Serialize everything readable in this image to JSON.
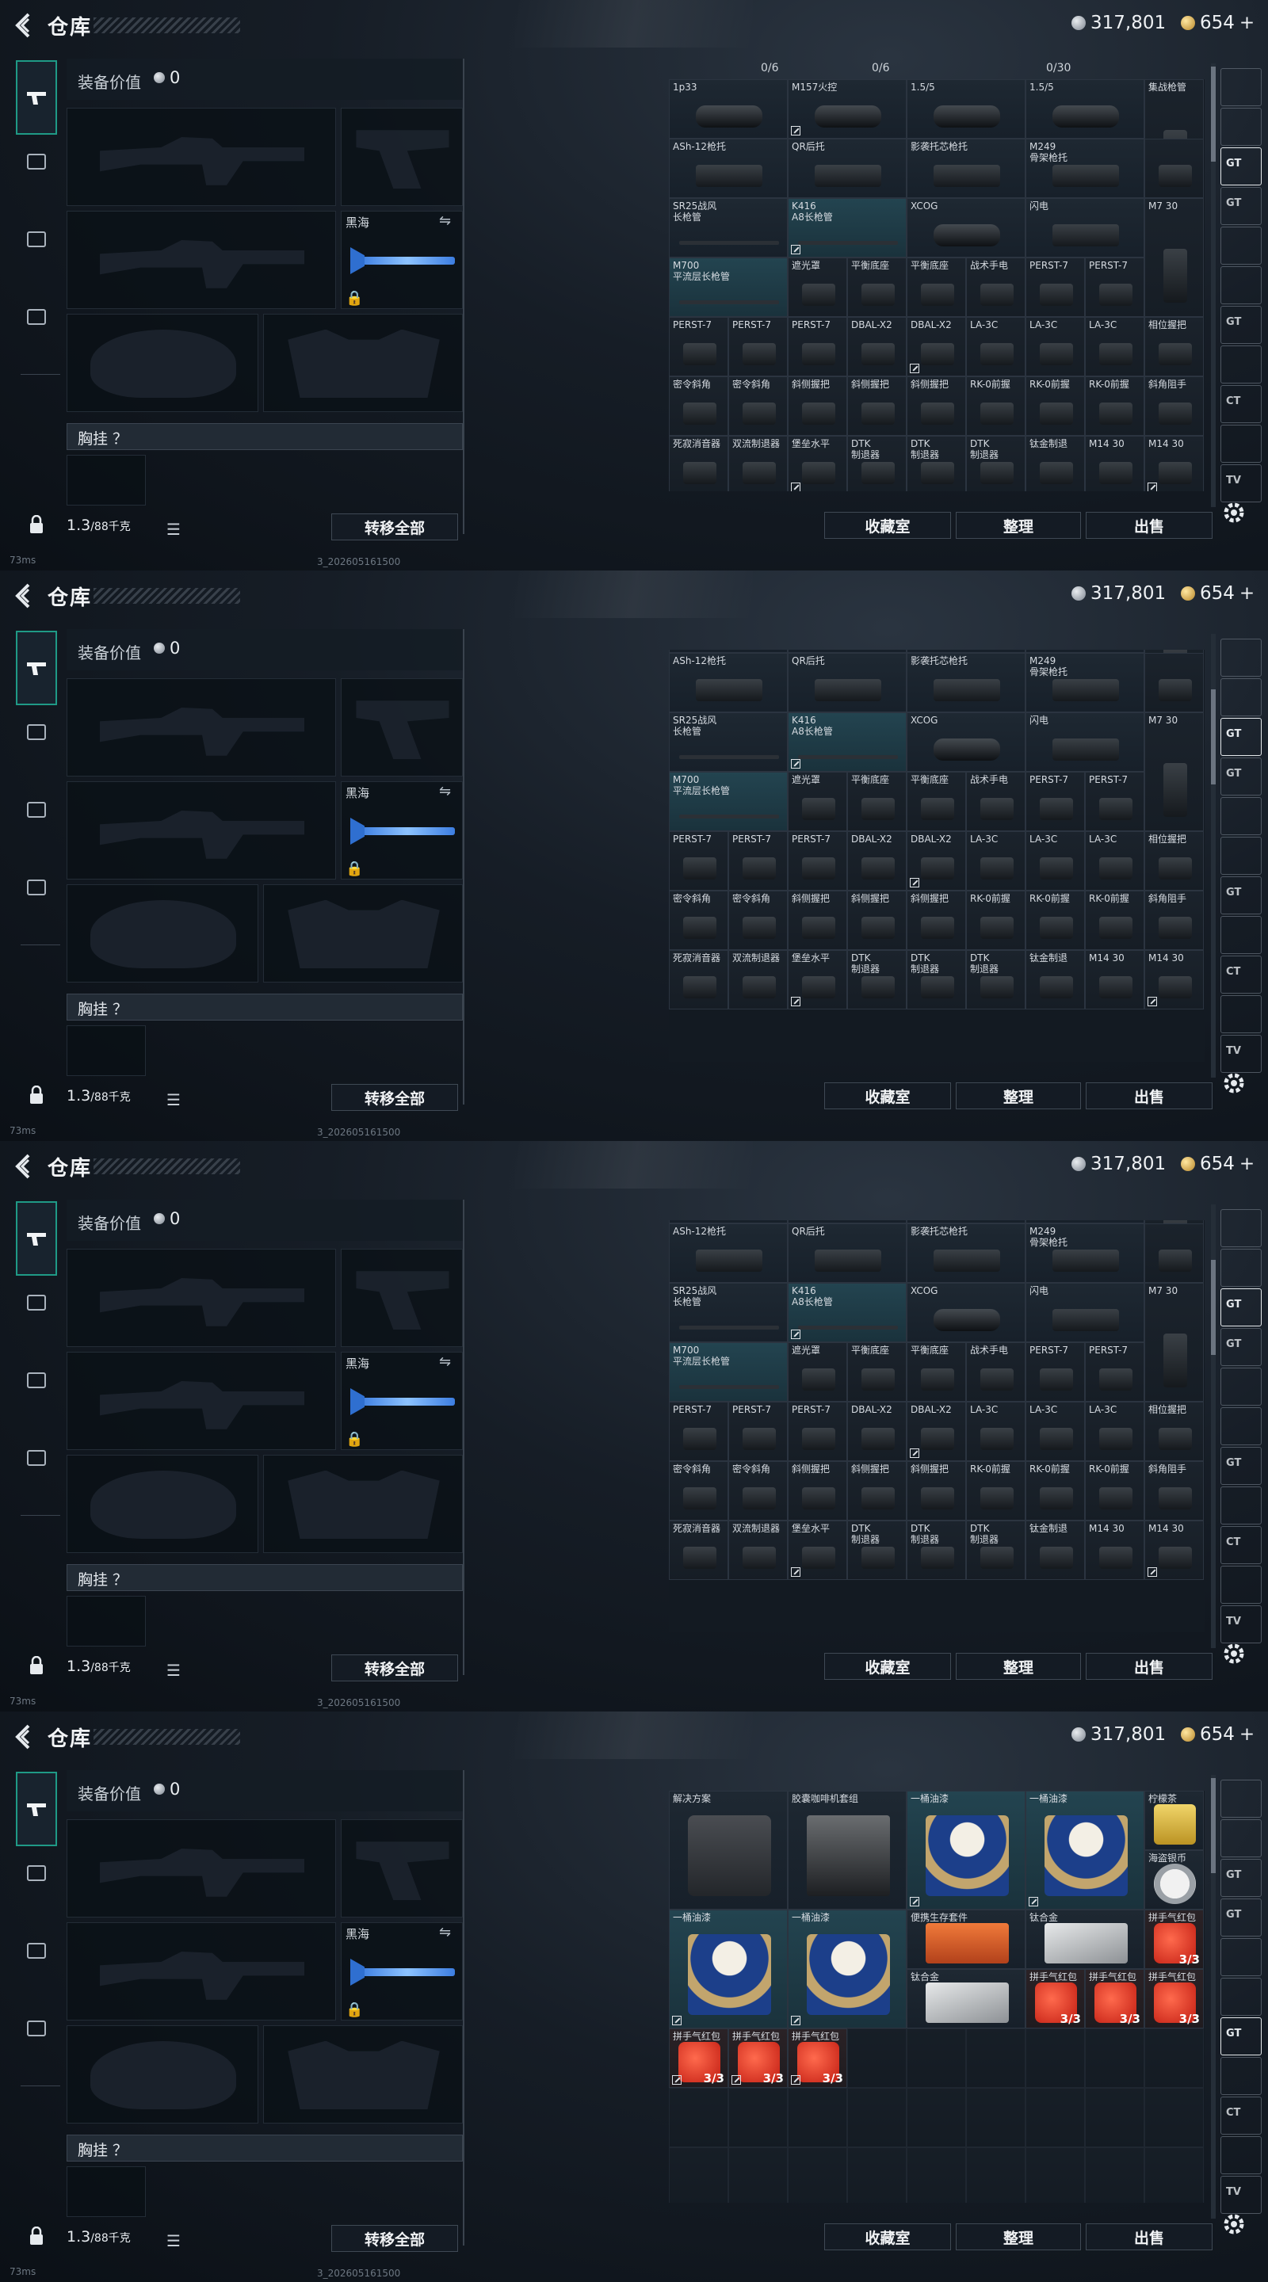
{
  "screens": [
    {
      "id": "s1",
      "variant": "attachments",
      "offset": 0
    },
    {
      "id": "s2",
      "variant": "attachments-scrolled",
      "offset": 1
    },
    {
      "id": "s3",
      "variant": "attachments-scrolled",
      "offset": 1
    },
    {
      "id": "s4",
      "variant": "consumables",
      "offset": 0
    }
  ],
  "header": {
    "title": "仓库",
    "silver": "317,801",
    "gold": "654",
    "gold_plus": "+"
  },
  "loadout": {
    "value_label": "装备价值",
    "value": "0",
    "knife_label": "黑海",
    "chest_label": "胸挂 ？",
    "weight": "1.3",
    "weight_cap": "/88千克",
    "transfer_all": "转移全部"
  },
  "warehouse": {
    "filters": [
      "0/6",
      "0/6",
      "0/30"
    ],
    "buttons": {
      "vault": "收藏室",
      "sort": "整理",
      "sell": "出售"
    },
    "attachments": [
      {
        "row": 0,
        "cells": [
          "1p33",
          "M157火控",
          "1.5/5",
          "1.5/5",
          "集战枪管"
        ]
      },
      {
        "row": 1,
        "cells": [
          "ASh-12枪托",
          "QR后托",
          "影袭托芯枪托",
          "M249\n骨架枪托",
          ""
        ]
      },
      {
        "row": 2,
        "cells": [
          "SR25战风\n长枪管",
          "K416\nA8长枪管",
          "XCOG",
          "闪电",
          "M7 30"
        ]
      },
      {
        "row": 3,
        "cells": [
          "M700\n平流层长枪管",
          "遮光罩",
          "平衡底座",
          "平衡底座",
          "战术手电",
          "PERST-7",
          "PERST-7"
        ]
      },
      {
        "row": 4,
        "cells": [
          "PERST-7",
          "PERST-7",
          "PERST-7",
          "DBAL-X2",
          "DBAL-X2",
          "LA-3C",
          "LA-3C",
          "LA-3C",
          "相位握把"
        ]
      },
      {
        "row": 5,
        "cells": [
          "密令斜角",
          "密令斜角",
          "斜侧握把",
          "斜侧握把",
          "斜侧握把",
          "RK-0前握",
          "RK-0前握",
          "RK-0前握",
          "斜角阻手"
        ]
      },
      {
        "row": 6,
        "cells": [
          "死寂消音器",
          "双流制退器",
          "堡垒水平",
          "DTK\n制退器",
          "DTK\n制退器",
          "DTK\n制退器",
          "钛金制退",
          "M14 30",
          "M14 30"
        ]
      }
    ],
    "consumables": [
      {
        "name": "解决方案"
      },
      {
        "name": "胶囊咖啡机套组"
      },
      {
        "name": "一桶油漆"
      },
      {
        "name": "一桶油漆"
      },
      {
        "name": "柠檬茶"
      },
      {
        "name": "海盗银币"
      },
      {
        "name": "一桶油漆"
      },
      {
        "name": "一桶油漆"
      },
      {
        "name": "便携生存套件"
      },
      {
        "name": "钛合金"
      },
      {
        "name": "拼手气红包",
        "count": "3/3"
      },
      {
        "name": "钛合金"
      },
      {
        "name": "拼手气红包",
        "count": "3/3"
      },
      {
        "name": "拼手气红包",
        "count": "3/3"
      },
      {
        "name": "拼手气红包",
        "count": "3/3"
      },
      {
        "name": "拼手气红包",
        "count": "3/3"
      },
      {
        "name": "拼手气红包",
        "count": "3/3"
      },
      {
        "name": "拼手气红包",
        "count": "3/3"
      }
    ]
  },
  "rail": [
    "",
    "",
    "GT",
    "GT",
    "",
    "",
    "GT",
    "",
    "CT",
    "",
    "TV"
  ],
  "status": {
    "ping": "73ms",
    "build": "3_202605161500"
  },
  "colors": {
    "accent": "#1f9a86",
    "bg": "#0c1118",
    "gold": "#b7862a"
  }
}
